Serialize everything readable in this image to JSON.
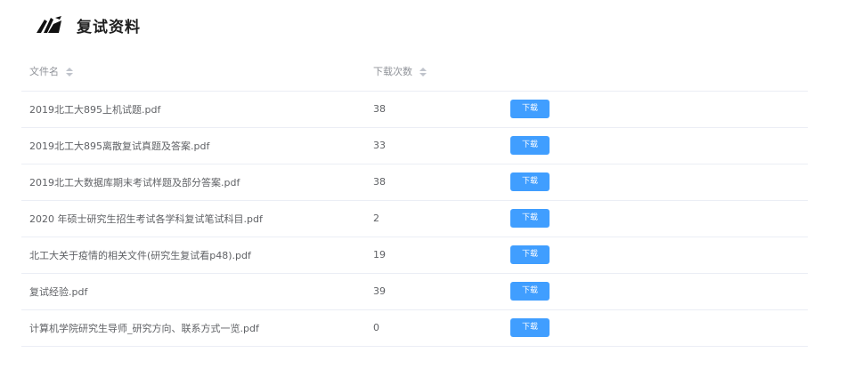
{
  "page": {
    "title": "复试资料",
    "logo_icon": "brand-logo-icon"
  },
  "table": {
    "columns": {
      "name": "文件名",
      "count": "下载次数"
    },
    "download_label": "下载",
    "rows": [
      {
        "name": "2019北工大895上机试题.pdf",
        "count": "38"
      },
      {
        "name": "2019北工大895离散复试真题及答案.pdf",
        "count": "33"
      },
      {
        "name": "2019北工大数据库期末考试样题及部分答案.pdf",
        "count": "38"
      },
      {
        "name": "2020 年硕士研究生招生考试各学科复试笔试科目.pdf",
        "count": "2"
      },
      {
        "name": "北工大关于疫情的相关文件(研究生复试看p48).pdf",
        "count": "19"
      },
      {
        "name": "复试经验.pdf",
        "count": "39"
      },
      {
        "name": "计算机学院研究生导师_研究方向、联系方式一览.pdf",
        "count": "0"
      }
    ]
  },
  "colors": {
    "button_bg": "#409eff",
    "header_text": "#909399",
    "cell_text": "#606266",
    "row_border": "#ebeef5"
  }
}
